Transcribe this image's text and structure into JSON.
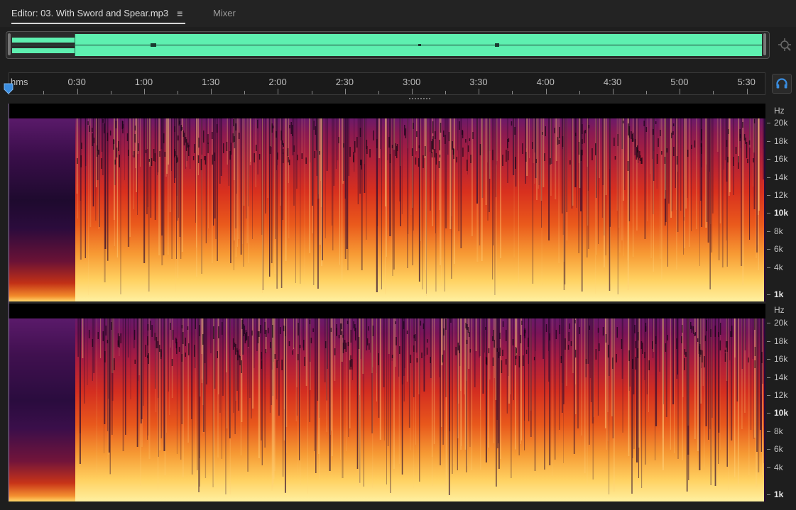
{
  "tabs": {
    "editor_label": "Editor: 03. With Sword and Spear.mp3",
    "editor_menu_icon": "hamburger-menu-icon",
    "mixer_label": "Mixer"
  },
  "colors": {
    "overview_wave": "#5ef0b0",
    "accent_blue": "#3a8de0",
    "spectrum_low": "#ffe27a",
    "spectrum_mid": "#e23a1c",
    "spectrum_high": "#5a1278"
  },
  "ruler": {
    "unit_label": "hms",
    "labels": [
      "0:30",
      "1:00",
      "1:30",
      "2:00",
      "2:30",
      "3:00",
      "3:30",
      "4:00",
      "4:30",
      "5:00",
      "5:30"
    ]
  },
  "channels": [
    {
      "name": "channel-1",
      "unit": "Hz",
      "freq_labels": [
        {
          "text": "20k",
          "bold": false
        },
        {
          "text": "18k",
          "bold": false
        },
        {
          "text": "16k",
          "bold": false
        },
        {
          "text": "14k",
          "bold": false
        },
        {
          "text": "12k",
          "bold": false
        },
        {
          "text": "10k",
          "bold": true
        },
        {
          "text": "8k",
          "bold": false
        },
        {
          "text": "6k",
          "bold": false
        },
        {
          "text": "4k",
          "bold": false
        },
        {
          "text": "1k",
          "bold": true
        }
      ]
    },
    {
      "name": "channel-2",
      "unit": "Hz",
      "freq_labels": [
        {
          "text": "20k",
          "bold": false
        },
        {
          "text": "18k",
          "bold": false
        },
        {
          "text": "16k",
          "bold": false
        },
        {
          "text": "14k",
          "bold": false
        },
        {
          "text": "12k",
          "bold": false
        },
        {
          "text": "10k",
          "bold": true
        },
        {
          "text": "8k",
          "bold": false
        },
        {
          "text": "6k",
          "bold": false
        },
        {
          "text": "4k",
          "bold": false
        },
        {
          "text": "1k",
          "bold": true
        }
      ]
    }
  ]
}
